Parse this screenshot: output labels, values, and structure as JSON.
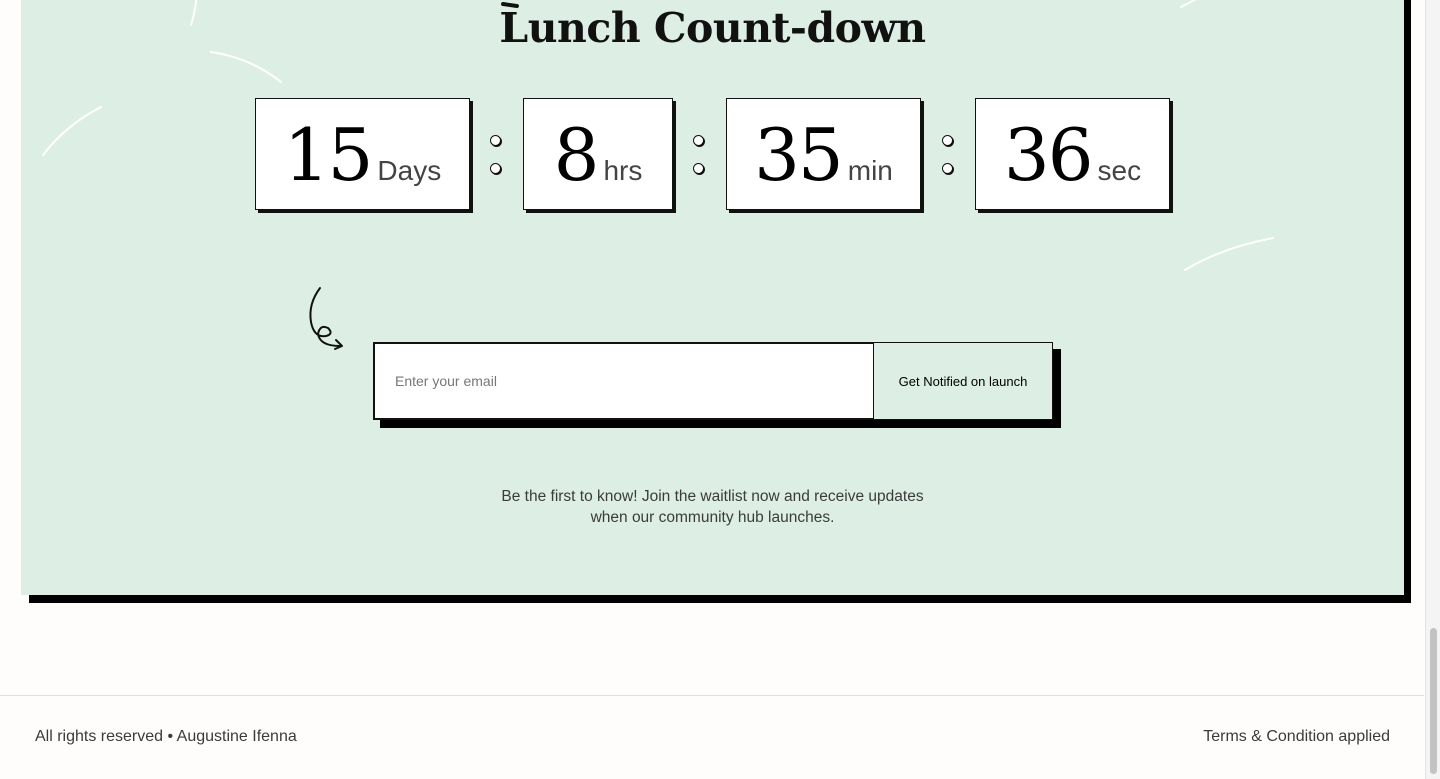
{
  "countdown": {
    "title": "Lunch Count-down",
    "days": {
      "value": "15",
      "unit": "Days"
    },
    "hours": {
      "value": "8",
      "unit": "hrs"
    },
    "minutes": {
      "value": "35",
      "unit": "min"
    },
    "seconds": {
      "value": "36",
      "unit": "sec"
    }
  },
  "signup": {
    "email_placeholder": "Enter your email",
    "email_value": "",
    "button_label": "Get Notified on launch"
  },
  "description": {
    "line1": "Be the first to know! Join the waitlist now and receive updates",
    "line2": "when our community hub launches."
  },
  "footer": {
    "copyright": "All rights reserved • Augustine Ifenna",
    "terms": "Terms & Condition applied"
  },
  "colors": {
    "hero_background": "#ddefe5",
    "shadow": "#000000",
    "page_background": "#fffdfb",
    "text": "#3b3b3b"
  },
  "icons": {
    "arrow": "curly-arrow-icon",
    "separator": "colon-dots-icon"
  }
}
